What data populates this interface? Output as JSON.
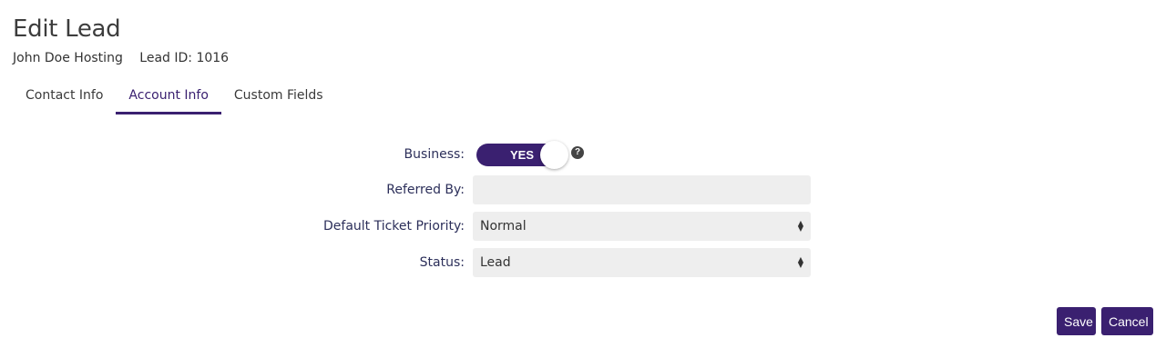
{
  "header": {
    "title": "Edit Lead",
    "lead_name": "John Doe Hosting",
    "lead_id": "Lead ID: 1016"
  },
  "tabs": [
    {
      "label": "Contact Info",
      "active": false
    },
    {
      "label": "Account Info",
      "active": true
    },
    {
      "label": "Custom Fields",
      "active": false
    }
  ],
  "form": {
    "business": {
      "label": "Business:",
      "toggle_text": "YES",
      "value": true
    },
    "referred_by": {
      "label": "Referred By:",
      "value": ""
    },
    "default_ticket_priority": {
      "label": "Default Ticket Priority:",
      "value": "Normal"
    },
    "status": {
      "label": "Status:",
      "value": "Lead"
    }
  },
  "actions": {
    "save_label": "Save",
    "cancel_label": "Cancel"
  },
  "colors": {
    "accent": "#3a2070",
    "field_bg": "#eeeeee"
  },
  "icons": {
    "help": "question-circle-icon"
  }
}
